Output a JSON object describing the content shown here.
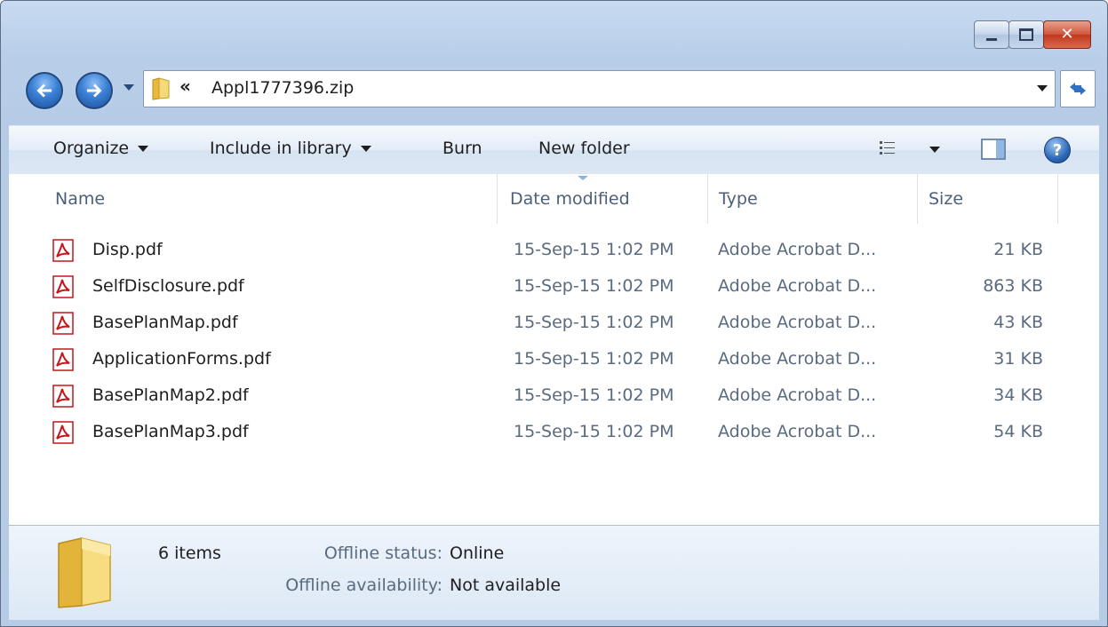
{
  "window": {
    "title_buttons": [
      "minimize",
      "maximize",
      "close"
    ],
    "icons": {
      "minimize": "minimize-icon",
      "maximize": "maximize-icon",
      "close": "close-icon"
    }
  },
  "navigation": {
    "address_chevron": "«",
    "address_text": "Appl1777396.zip",
    "icons": [
      "back-arrow-icon",
      "forward-arrow-icon",
      "folder-icon",
      "refresh-icon"
    ]
  },
  "toolbar": {
    "organize_label": "Organize",
    "include_label": "Include in library",
    "burn_label": "Burn",
    "new_folder_label": "New folder",
    "icons": [
      "views-icon",
      "preview-pane-icon",
      "help-icon"
    ]
  },
  "columns": {
    "name": "Name",
    "date": "Date modified",
    "type": "Type",
    "size": "Size"
  },
  "files": [
    {
      "name": "Disp.pdf",
      "date": "15-Sep-15 1:02 PM",
      "type": "Adobe Acrobat D...",
      "size": "21 KB"
    },
    {
      "name": "SelfDisclosure.pdf",
      "date": "15-Sep-15 1:02 PM",
      "type": "Adobe Acrobat D...",
      "size": "863 KB"
    },
    {
      "name": "BasePlanMap.pdf",
      "date": "15-Sep-15 1:02 PM",
      "type": "Adobe Acrobat D...",
      "size": "43 KB"
    },
    {
      "name": "ApplicationForms.pdf",
      "date": "15-Sep-15 1:02 PM",
      "type": "Adobe Acrobat D...",
      "size": "31 KB"
    },
    {
      "name": "BasePlanMap2.pdf",
      "date": "15-Sep-15 1:02 PM",
      "type": "Adobe Acrobat D...",
      "size": "34 KB"
    },
    {
      "name": "BasePlanMap3.pdf",
      "date": "15-Sep-15 1:02 PM",
      "type": "Adobe Acrobat D...",
      "size": "54 KB"
    }
  ],
  "details": {
    "count": "6 items",
    "offline_status_label": "Offline status:",
    "offline_status_value": "Online",
    "offline_availability_label": "Offline availability:",
    "offline_availability_value": "Not available"
  },
  "colors": {
    "frame": "#b9cfe9",
    "close_button": "#c0371d",
    "pdf_red": "#c4161c",
    "secondary_text": "#5a6b80"
  }
}
